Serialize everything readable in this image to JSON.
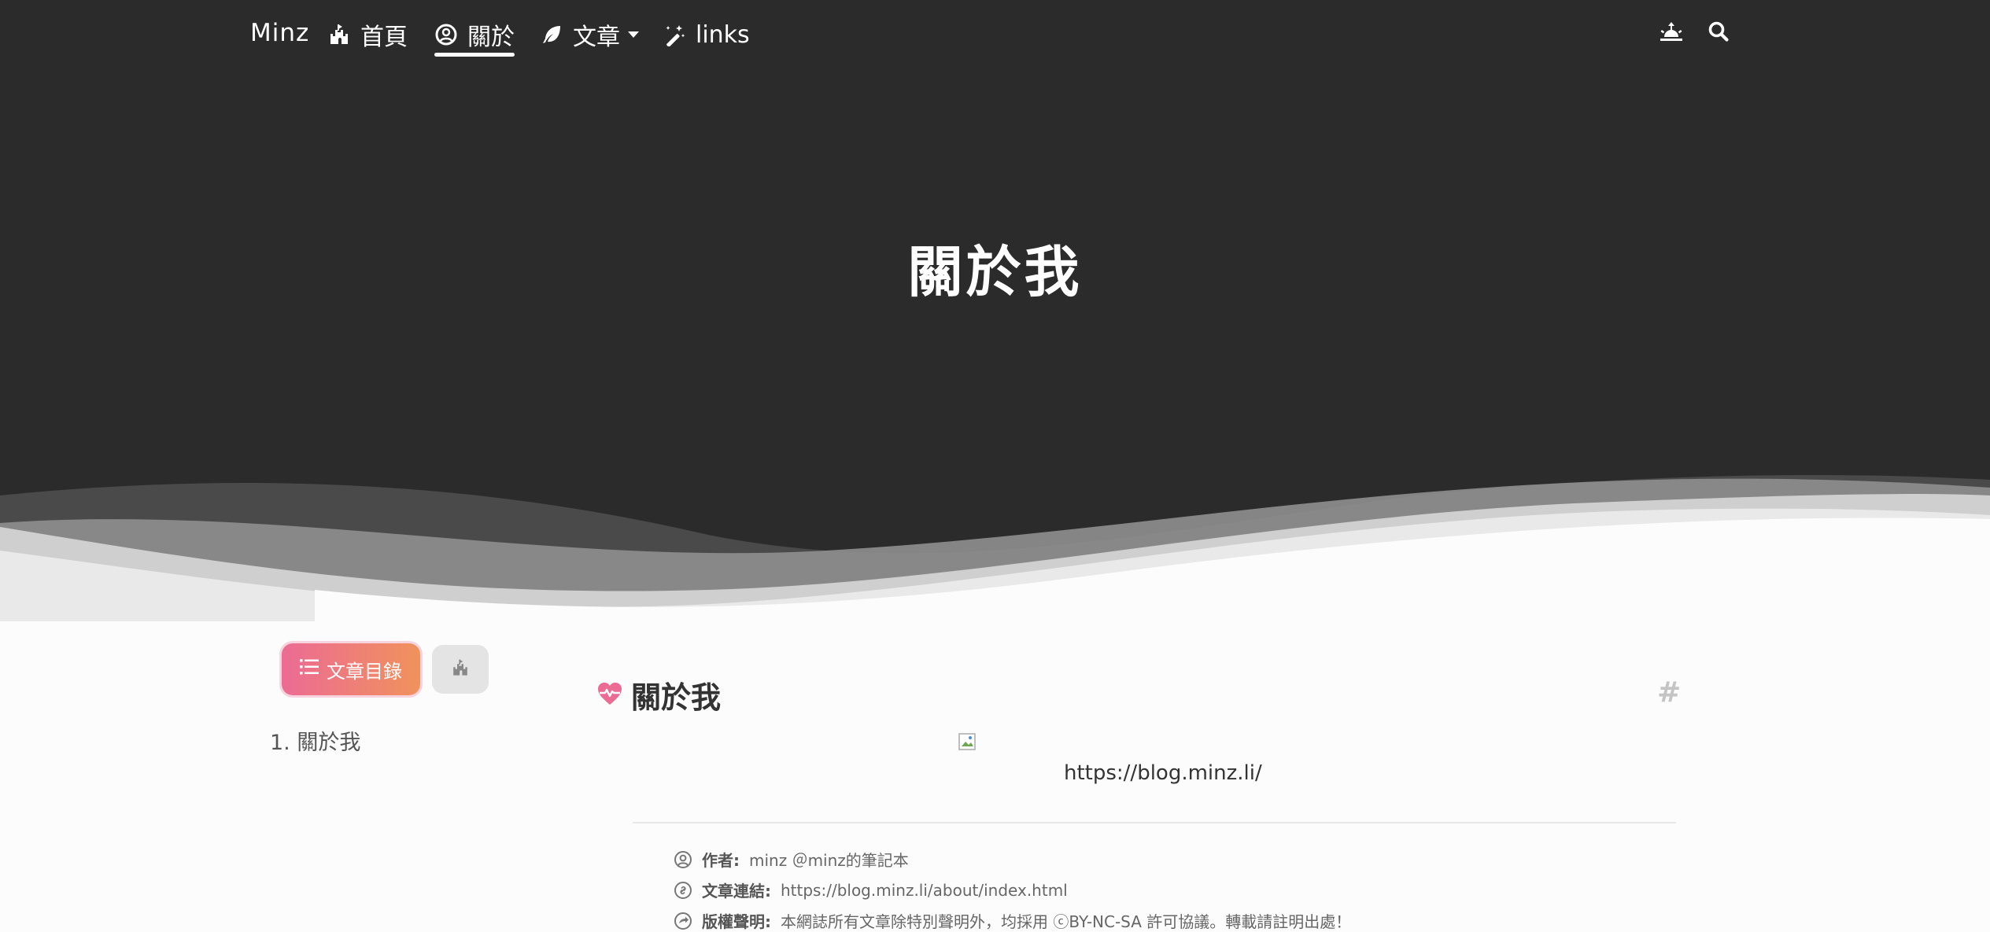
{
  "nav": {
    "brand": "Minz",
    "items": [
      {
        "label": "首頁",
        "icon": "castle-icon"
      },
      {
        "label": "關於",
        "icon": "user-circle-icon",
        "active": true
      },
      {
        "label": "文章",
        "icon": "feather-icon",
        "dropdown": true
      },
      {
        "label": "links",
        "icon": "magic-wand-icon"
      }
    ],
    "theme_icon": "sunrise-icon",
    "search_icon": "search-icon"
  },
  "hero": {
    "title": "關於我"
  },
  "sidebar": {
    "toc_button": "文章目錄",
    "home_icon": "castle-icon",
    "toc": [
      {
        "number": "1.",
        "label": "關於我"
      }
    ]
  },
  "post": {
    "heading": "關於我",
    "heading_icon": "heartbeat-icon",
    "anchor": "#",
    "image_caption": "https://blog.minz.li/",
    "meta": {
      "author_label": "作者:",
      "author_value": "minz ＠minz的筆記本",
      "link_label": "文章連結:",
      "link_value": "https://blog.minz.li/about/index.html",
      "copyright_label": "版權聲明:",
      "copyright_value": "本網誌所有文章除特別聲明外，均採用 ⓒBY-NC-SA 許可協議。轉載請註明出處！"
    }
  },
  "colors": {
    "hero_bg": "#2b2b2b",
    "accent_start": "#ec6b95",
    "accent_end": "#f0925c"
  }
}
